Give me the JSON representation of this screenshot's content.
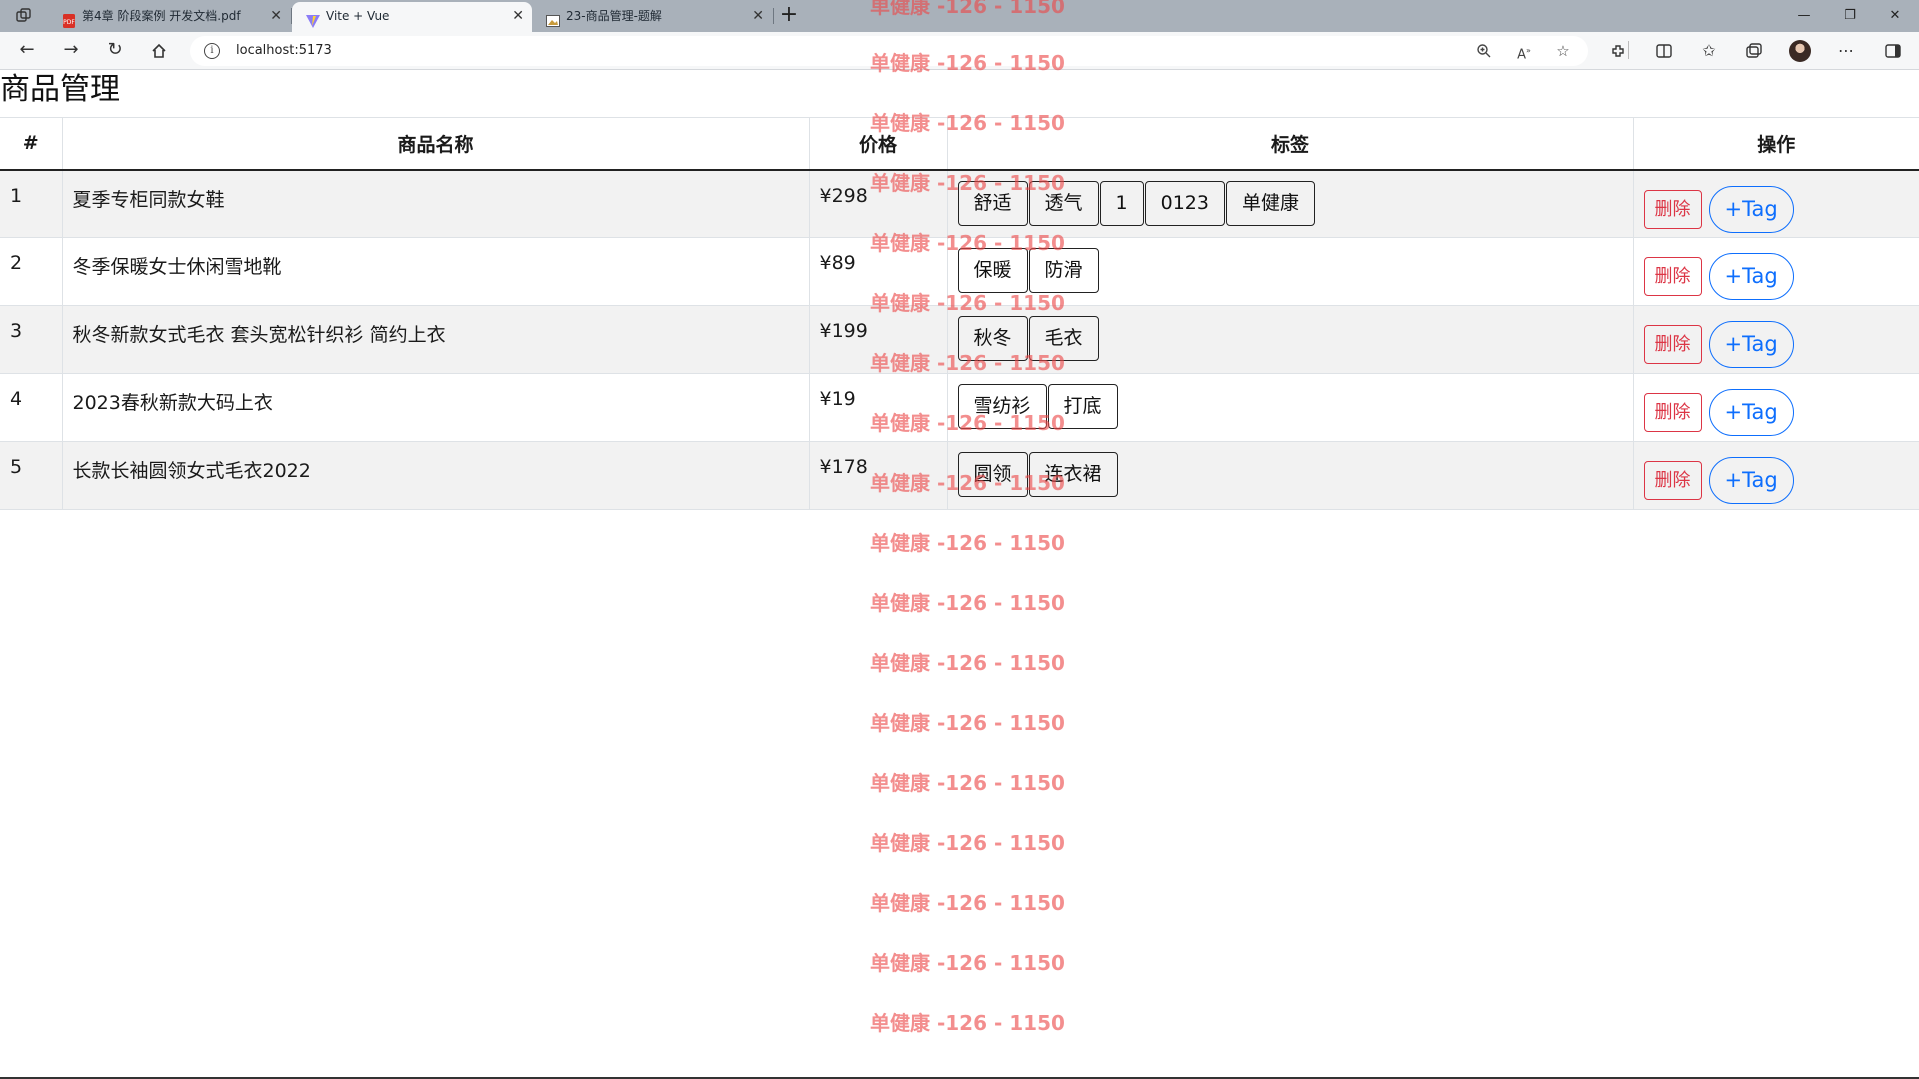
{
  "browser": {
    "tabs": [
      {
        "title": "第4章 阶段案例 开发文档.pdf",
        "icon": "pdf-icon"
      },
      {
        "title": "Vite + Vue",
        "icon": "vite-icon"
      },
      {
        "title": "23-商品管理-题解",
        "icon": "image-icon"
      }
    ],
    "address": "localhost:5173"
  },
  "page": {
    "title": "商品管理",
    "columns": [
      "#",
      "商品名称",
      "价格",
      "标签",
      "操作"
    ],
    "rows": [
      {
        "id": "1",
        "name": "夏季专柜同款女鞋",
        "price": "¥298",
        "tags": [
          "舒适",
          "透气",
          "1",
          "0123",
          "单健康"
        ]
      },
      {
        "id": "2",
        "name": "冬季保暖女士休闲雪地靴",
        "price": "¥89",
        "tags": [
          "保暖",
          "防滑"
        ]
      },
      {
        "id": "3",
        "name": "秋冬新款女式毛衣 套头宽松针织衫 简约上衣",
        "price": "¥199",
        "tags": [
          "秋冬",
          "毛衣"
        ]
      },
      {
        "id": "4",
        "name": "2023春秋新款大码上衣",
        "price": "¥19",
        "tags": [
          "雪纺衫",
          "打底"
        ]
      },
      {
        "id": "5",
        "name": "长款长袖圆领女式毛衣2022",
        "price": "¥178",
        "tags": [
          "圆领",
          "连衣裙"
        ]
      }
    ],
    "delete_label": "删除",
    "add_tag_label": "+Tag"
  },
  "watermark": {
    "text": "单健康 -126 - 1150",
    "color": "#eb4848"
  }
}
